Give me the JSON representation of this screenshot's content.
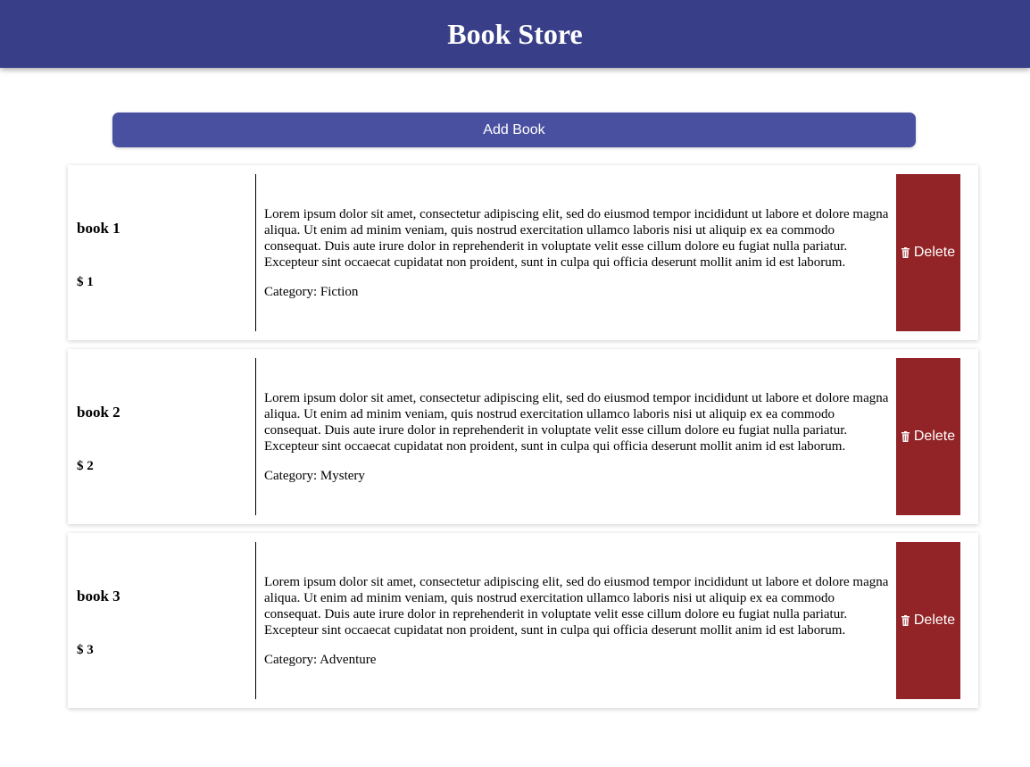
{
  "header": {
    "title": "Book Store"
  },
  "actions": {
    "add_label": "Add Book"
  },
  "books": [
    {
      "title": "book 1",
      "price": "$ 1",
      "description": "Lorem ipsum dolor sit amet, consectetur adipiscing elit, sed do eiusmod tempor incididunt ut labore et dolore magna aliqua. Ut enim ad minim veniam, quis nostrud exercitation ullamco laboris nisi ut aliquip ex ea commodo consequat. Duis aute irure dolor in reprehenderit in voluptate velit esse cillum dolore eu fugiat nulla pariatur. Excepteur sint occaecat cupidatat non proident, sunt in culpa qui officia deserunt mollit anim id est laborum.",
      "category": "Category: Fiction",
      "delete_label": "Delete",
      "delete_icon": "trash-icon"
    },
    {
      "title": "book 2",
      "price": "$ 2",
      "description": "Lorem ipsum dolor sit amet, consectetur adipiscing elit, sed do eiusmod tempor incididunt ut labore et dolore magna aliqua. Ut enim ad minim veniam, quis nostrud exercitation ullamco laboris nisi ut aliquip ex ea commodo consequat. Duis aute irure dolor in reprehenderit in voluptate velit esse cillum dolore eu fugiat nulla pariatur. Excepteur sint occaecat cupidatat non proident, sunt in culpa qui officia deserunt mollit anim id est laborum.",
      "category": "Category: Mystery",
      "delete_label": "Delete",
      "delete_icon": "trash-icon"
    },
    {
      "title": "book 3",
      "price": "$ 3",
      "description": "Lorem ipsum dolor sit amet, consectetur adipiscing elit, sed do eiusmod tempor incididunt ut labore et dolore magna aliqua. Ut enim ad minim veniam, quis nostrud exercitation ullamco laboris nisi ut aliquip ex ea commodo consequat. Duis aute irure dolor in reprehenderit in voluptate velit esse cillum dolore eu fugiat nulla pariatur. Excepteur sint occaecat cupidatat non proident, sunt in culpa qui officia deserunt mollit anim id est laborum.",
      "category": "Category: Adventure",
      "delete_label": "Delete",
      "delete_icon": "trash-icon"
    }
  ],
  "colors": {
    "header_bg": "#383f88",
    "add_button_bg": "#4a50a0",
    "delete_button_bg": "#922326"
  }
}
